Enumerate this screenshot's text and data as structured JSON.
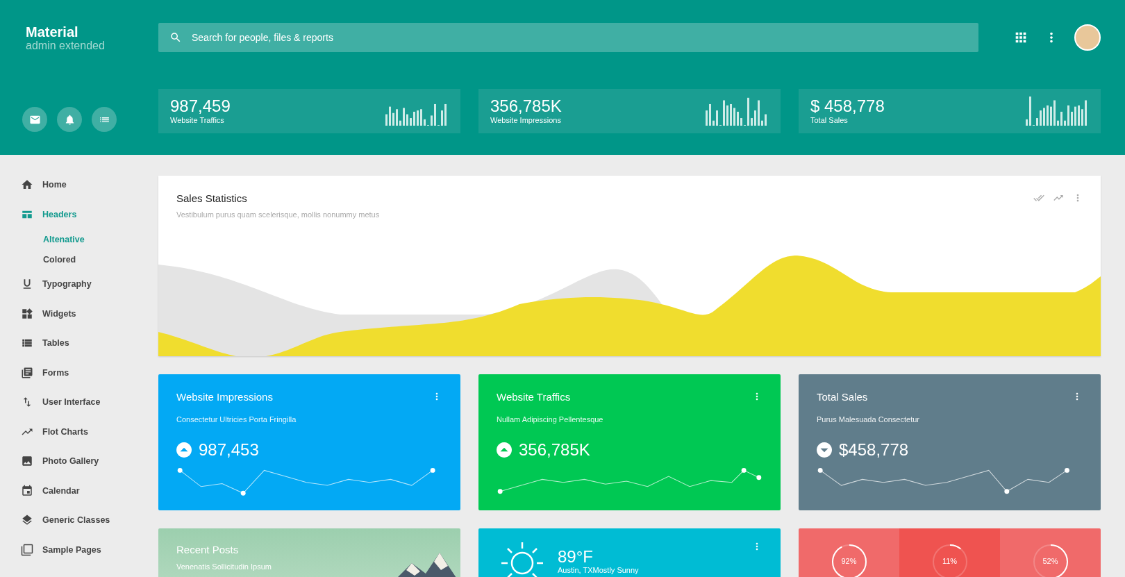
{
  "brand": {
    "title": "Material",
    "subtitle": "admin extended"
  },
  "search": {
    "placeholder": "Search for people, files & reports"
  },
  "stats": [
    {
      "value": "987,459",
      "label": "Website Traffics"
    },
    {
      "value": "356,785K",
      "label": "Website Impressions"
    },
    {
      "value": "$ 458,778",
      "label": "Total Sales"
    }
  ],
  "sidebar": {
    "items": [
      {
        "label": "Home",
        "selected": false
      },
      {
        "label": "Headers",
        "selected": true,
        "expanded": true,
        "children": [
          {
            "label": "Altenative",
            "selected": true
          },
          {
            "label": "Colored",
            "selected": false
          }
        ]
      },
      {
        "label": "Typography",
        "selected": false
      },
      {
        "label": "Widgets",
        "selected": false
      },
      {
        "label": "Tables",
        "selected": false
      },
      {
        "label": "Forms",
        "selected": false
      },
      {
        "label": "User Interface",
        "selected": false
      },
      {
        "label": "Flot Charts",
        "selected": false
      },
      {
        "label": "Photo Gallery",
        "selected": false
      },
      {
        "label": "Calendar",
        "selected": false
      },
      {
        "label": "Generic Classes",
        "selected": false
      },
      {
        "label": "Sample Pages",
        "selected": false
      }
    ]
  },
  "sales_chart": {
    "title": "Sales Statistics",
    "subtitle": "Vestibulum purus quam scelerisque, mollis nonummy metus"
  },
  "metric_cards": [
    {
      "title": "Website Impressions",
      "subtitle": "Consectetur Ultricies Porta Fringilla",
      "value": "987,453",
      "kind": "up",
      "color": "#03a9f4"
    },
    {
      "title": "Website Traffics",
      "subtitle": "Nullam Adipiscing Pellentesque",
      "value": "356,785K",
      "kind": "up",
      "color": "#00c853"
    },
    {
      "title": "Total Sales",
      "subtitle": "Purus Malesuada Consectetur",
      "value": "$458,778",
      "kind": "down",
      "color": "#607d8b"
    }
  ],
  "recent_posts": {
    "title": "Recent Posts",
    "subtitle": "Venenatis Sollicitudin Ipsum"
  },
  "weather": {
    "temperature": "89°F",
    "location": "Austin, TXMostly Sunny"
  },
  "progress": [
    {
      "reading": "92%",
      "level": 0.92,
      "color": "#f06a6a"
    },
    {
      "reading": "11%",
      "level": 0.11,
      "color": "#ef5350"
    },
    {
      "reading": "52%",
      "level": 0.52,
      "color": "#f06a6a"
    }
  ]
}
